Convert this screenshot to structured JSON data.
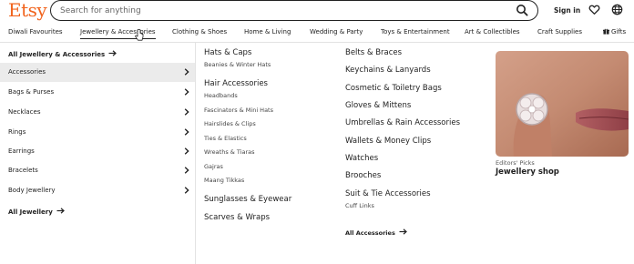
{
  "brand": {
    "logo": "Etsy",
    "color": "#f1641e"
  },
  "search": {
    "placeholder": "Search for anything",
    "icon": "search-icon"
  },
  "header": {
    "signin": "Sign in",
    "favorites_icon": "heart-icon",
    "locale_icon": "globe-icon"
  },
  "nav": {
    "items": [
      {
        "label": "Diwali Favourites"
      },
      {
        "label": "Jewellery & Accessories",
        "active": true
      },
      {
        "label": "Clothing & Shoes"
      },
      {
        "label": "Home & Living"
      },
      {
        "label": "Wedding & Party"
      },
      {
        "label": "Toys & Entertainment"
      },
      {
        "label": "Art & Collectibles"
      },
      {
        "label": "Craft Supplies"
      },
      {
        "label": "Gifts",
        "icon": "gift-icon"
      }
    ]
  },
  "sidebar": {
    "top_link": "All Jewellery & Accessories",
    "items": [
      {
        "label": "Accessories",
        "active": true
      },
      {
        "label": "Bags & Purses"
      },
      {
        "label": "Necklaces"
      },
      {
        "label": "Rings"
      },
      {
        "label": "Earrings"
      },
      {
        "label": "Bracelets"
      },
      {
        "label": "Body Jewellery"
      }
    ],
    "bottom_link": "All Jewellery"
  },
  "columns": {
    "col1": [
      {
        "heading": "Hats & Caps",
        "subs": [
          "Beanies & Winter Hats"
        ]
      },
      {
        "heading": "Hair Accessories",
        "subs": [
          "Headbands",
          "Fascinators & Mini Hats",
          "Hairslides & Clips",
          "Ties & Elastics",
          "Wreaths & Tiaras",
          "Gajras",
          "Maang Tikkas"
        ]
      },
      {
        "heading": "Sunglasses & Eyewear",
        "subs": []
      },
      {
        "heading": "Scarves & Wraps",
        "subs": []
      }
    ],
    "col2": [
      {
        "heading": "Belts & Braces",
        "subs": []
      },
      {
        "heading": "Keychains & Lanyards",
        "subs": []
      },
      {
        "heading": "Cosmetic & Toiletry Bags",
        "subs": []
      },
      {
        "heading": "Gloves & Mittens",
        "subs": []
      },
      {
        "heading": "Umbrellas & Rain Accessories",
        "subs": []
      },
      {
        "heading": "Wallets & Money Clips",
        "subs": []
      },
      {
        "heading": "Watches",
        "subs": []
      },
      {
        "heading": "Brooches",
        "subs": []
      },
      {
        "heading": "Suit & Tie Accessories",
        "subs": [
          "Cuff Links"
        ]
      }
    ],
    "col2_link": "All Accessories"
  },
  "feature": {
    "kicker": "Editors' Picks",
    "title": "Jewellery shop"
  }
}
